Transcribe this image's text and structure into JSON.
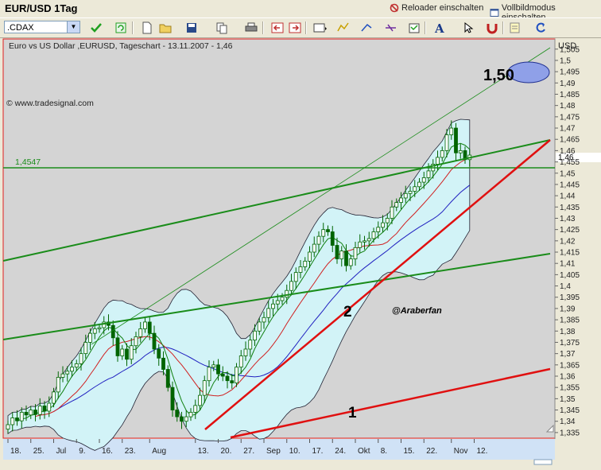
{
  "window": {
    "title": "EUR/USD 1Tag",
    "actions": [
      "Reloader einschalten",
      "Vollbildmodus einschalten"
    ]
  },
  "toolbar": {
    "symbol_value": ".CDAX"
  },
  "chart": {
    "header": "Euro vs US Dollar ,EURUSD, Tageschart - 13.11.2007 - 1,46",
    "copyright": "© www.tradesignal.com",
    "currency": "USD",
    "hline_label": "1,4547",
    "current_price_label": "1,46",
    "annotations": {
      "target": "1,50",
      "author": "@Araberfan",
      "line_1": "1",
      "line_2": "2"
    }
  },
  "colors": {
    "plot_bg": "#d4d4d4",
    "band_fill": "#d2f3f7",
    "candle": "#006400",
    "trend_green": "#1a8c1a",
    "trend_red": "#e01010",
    "ma_blue": "#2020c0",
    "ma_red": "#d02020",
    "ma_green": "#108010"
  },
  "chart_data": {
    "type": "candlestick",
    "title": "Euro vs US Dollar ,EURUSD, Tageschart - 13.11.2007 - 1,46",
    "ylabel": "USD",
    "ylim": [
      1.3325,
      1.5095
    ],
    "x_tick_labels": [
      "18.",
      "25.",
      "Jul",
      "9.",
      "16.",
      "23.",
      "Aug",
      "13.",
      "20.",
      "27.",
      "Sep",
      "10.",
      "17.",
      "24.",
      "Okt",
      "8.",
      "15.",
      "22.",
      "Nov",
      "12."
    ],
    "x_tick_index": [
      0,
      5,
      10,
      15,
      20,
      25,
      31,
      41,
      46,
      51,
      56,
      61,
      66,
      71,
      76,
      81,
      86,
      91,
      97,
      102
    ],
    "y_ticks": [
      1.335,
      1.34,
      1.345,
      1.35,
      1.355,
      1.36,
      1.365,
      1.37,
      1.375,
      1.38,
      1.385,
      1.39,
      1.395,
      1.4,
      1.405,
      1.41,
      1.415,
      1.42,
      1.425,
      1.43,
      1.435,
      1.44,
      1.445,
      1.45,
      1.455,
      1.46,
      1.465,
      1.47,
      1.475,
      1.48,
      1.485,
      1.49,
      1.495,
      1.5,
      1.505
    ],
    "close": [
      1.3385,
      1.3415,
      1.3402,
      1.344,
      1.3428,
      1.345,
      1.343,
      1.3468,
      1.3445,
      1.348,
      1.353,
      1.3595,
      1.361,
      1.3622,
      1.364,
      1.3655,
      1.37,
      1.375,
      1.379,
      1.381,
      1.3815,
      1.384,
      1.3825,
      1.377,
      1.369,
      1.372,
      1.3675,
      1.3735,
      1.3775,
      1.381,
      1.384,
      1.379,
      1.372,
      1.368,
      1.363,
      1.355,
      1.345,
      1.342,
      1.34,
      1.342,
      1.344,
      1.347,
      1.3515,
      1.358,
      1.364,
      1.365,
      1.361,
      1.36,
      1.358,
      1.357,
      1.364,
      1.369,
      1.372,
      1.376,
      1.38,
      1.384,
      1.386,
      1.39,
      1.392,
      1.3935,
      1.395,
      1.398,
      1.402,
      1.406,
      1.4085,
      1.411,
      1.415,
      1.4185,
      1.422,
      1.425,
      1.424,
      1.418,
      1.412,
      1.4155,
      1.409,
      1.412,
      1.417,
      1.4195,
      1.42,
      1.421,
      1.424,
      1.426,
      1.428,
      1.43,
      1.435,
      1.437,
      1.439,
      1.441,
      1.442,
      1.444,
      1.446,
      1.448,
      1.451,
      1.454,
      1.457,
      1.46,
      1.467,
      1.47,
      1.459,
      1.46,
      1.456,
      1.458
    ]
  }
}
